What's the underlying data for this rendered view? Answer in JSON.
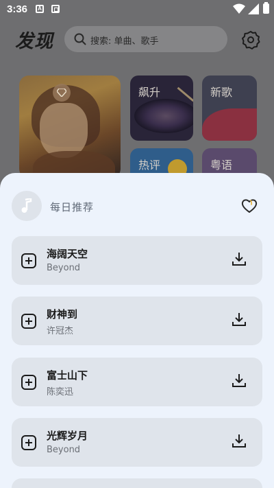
{
  "status_bar": {
    "time": "3:36",
    "notif_a": "A"
  },
  "header": {
    "title": "发现",
    "search_placeholder": "搜索: 单曲、歌手"
  },
  "tiles": [
    {
      "label": "飙升"
    },
    {
      "label": "新歌"
    },
    {
      "label": "热评"
    },
    {
      "label": "粤语"
    }
  ],
  "sheet": {
    "title": "每日推荐",
    "songs": [
      {
        "title": "海阔天空",
        "artist": "Beyond"
      },
      {
        "title": "财神到",
        "artist": "许冠杰"
      },
      {
        "title": "富士山下",
        "artist": "陈奕迅"
      },
      {
        "title": "光辉岁月",
        "artist": "Beyond"
      }
    ]
  }
}
